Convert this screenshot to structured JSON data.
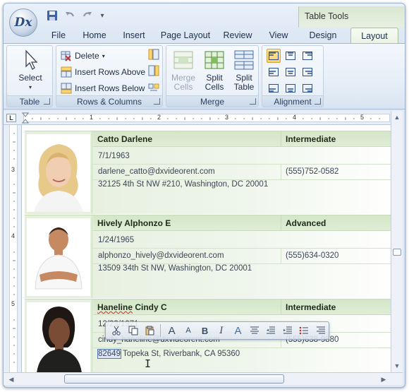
{
  "app": {
    "logo_text": "Dx",
    "context_tab_group": "Table Tools"
  },
  "tabs": [
    {
      "label": "File"
    },
    {
      "label": "Home"
    },
    {
      "label": "Insert"
    },
    {
      "label": "Page Layout"
    },
    {
      "label": "Review"
    },
    {
      "label": "View"
    },
    {
      "label": "Design"
    },
    {
      "label": "Layout",
      "active": true
    }
  ],
  "ribbon": {
    "table_group": {
      "label": "Table",
      "select_label": "Select"
    },
    "rows_columns_group": {
      "label": "Rows & Columns",
      "delete_label": "Delete",
      "insert_above_label": "Insert Rows Above",
      "insert_below_label": "Insert Rows Below"
    },
    "merge_group": {
      "label": "Merge",
      "merge_cells_label": "Merge Cells",
      "split_cells_label": "Split Cells",
      "split_table_label": "Split Table"
    },
    "alignment_group": {
      "label": "Alignment",
      "selected_index": 0
    }
  },
  "ruler": {
    "corner": "L",
    "h_numbers": [
      "1",
      "2",
      "3",
      "4",
      "5"
    ],
    "v_numbers": [
      "3",
      "4",
      "5"
    ]
  },
  "records": [
    {
      "name": "Catto Darlene",
      "level": "Intermediate",
      "birth": "7/1/1963",
      "email": "darlene_catto@dxvideorent.com",
      "phone": "(555)752-0582",
      "address": "32125 4th St NW #210, Washington, DC 20001"
    },
    {
      "name": "Hively Alphonzo E",
      "level": "Advanced",
      "birth": "1/24/1965",
      "email": "alphonzo_hively@dxvideorent.com",
      "phone": "(555)634-0320",
      "address": "13509 34th St NW, Washington, DC 20001"
    },
    {
      "name": "Haneline Cindy C",
      "level": "Intermediate",
      "birth": "12/23/1971",
      "email": "cindy_haneline@dxvideorent.com",
      "phone": "(555)638-9880",
      "address_zip": "82649",
      "address_rest": " Topeka St, Riverbank, CA 95360"
    }
  ],
  "colors": {
    "accent": "#2a4d86",
    "table_header": "#d4e6c8",
    "selection": "#ffcf62"
  }
}
